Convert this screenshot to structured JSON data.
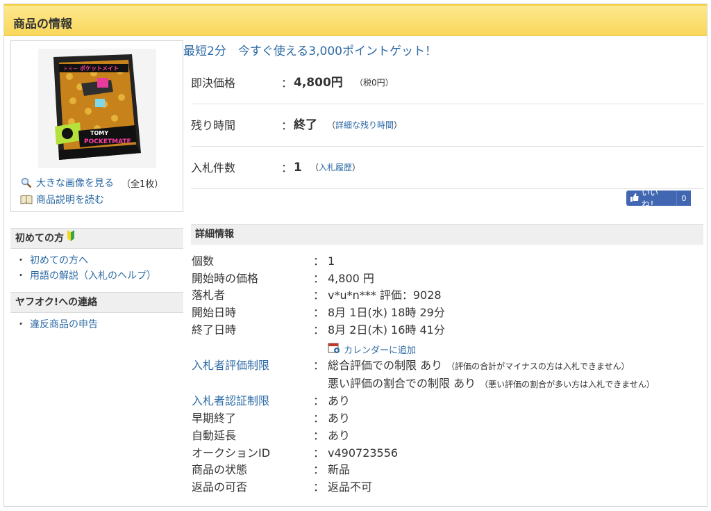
{
  "header": {
    "title": "商品の情報"
  },
  "image_panel": {
    "view_large_label": "大きな画像を見る",
    "image_count": "（全1枚）",
    "read_description_label": "商品説明を読む",
    "product_box_texts": [
      "トミー",
      "ポケットメイト",
      "TOMY",
      "POCKETMATE"
    ]
  },
  "promo": {
    "text": "最短2分　今すぐ使える3,000ポイントゲット！"
  },
  "summary": {
    "rows": [
      {
        "label": "即決価格",
        "colon": "：",
        "value": "4,800円",
        "sub": "（税0円）",
        "sub_link": ""
      },
      {
        "label": "残り時間",
        "colon": "：",
        "value": "終了",
        "sub_prefix": "（",
        "sub_link": "詳細な残り時間",
        "sub_suffix": "）"
      },
      {
        "label": "入札件数",
        "colon": "：",
        "value": "1",
        "sub_prefix": "（",
        "sub_link": "入札履歴",
        "sub_suffix": "）"
      }
    ]
  },
  "like": {
    "label": "いいね！",
    "count": "0",
    "color": "#4267b2"
  },
  "sidebar": {
    "beginners": {
      "title": "初めての方",
      "items": [
        "初めての方へ",
        "用語の解説（入札のヘルプ）"
      ]
    },
    "contact": {
      "title": "ヤフオク!への連絡",
      "items": [
        "違反商品の申告"
      ]
    }
  },
  "details": {
    "title": "詳細情報",
    "rows": [
      {
        "label": "個数",
        "value": "1"
      },
      {
        "label": "開始時の価格",
        "value": "4,800 円"
      },
      {
        "label": "落札者",
        "value": "v*u*n*** 評価：9028"
      },
      {
        "label": "開始日時",
        "value": "8月 1日(水) 18時 29分"
      },
      {
        "label": "終了日時",
        "value": "8月 2日(木) 16時 41分"
      },
      {
        "label": "入札者評価制限",
        "value": "総合評価での制限 あり",
        "note": "（評価の合計がマイナスの方は入札できません）"
      },
      {
        "label": "",
        "value": "悪い評価の割合での制限 あり",
        "note": "（悪い評価の割合が多い方は入札できません）"
      },
      {
        "label": "入札者認証制限",
        "value": "あり"
      },
      {
        "label": "早期終了",
        "value": "あり"
      },
      {
        "label": "自動延長",
        "value": "あり"
      },
      {
        "label": "オークションID",
        "value": "v490723556"
      },
      {
        "label": "商品の状態",
        "value": "新品"
      },
      {
        "label": "返品の可否",
        "value": "返品不可"
      }
    ],
    "colon": "：",
    "calendar_link": "カレンダーに追加"
  },
  "colors": {
    "accent": "#2c6aa4",
    "header_bg": "#f9d75b",
    "section_bg": "#efefef"
  },
  "icons": [
    "magnifier-icon",
    "book-icon",
    "beginner-mark-icon",
    "calendar-icon",
    "thumbs-up-icon"
  ]
}
